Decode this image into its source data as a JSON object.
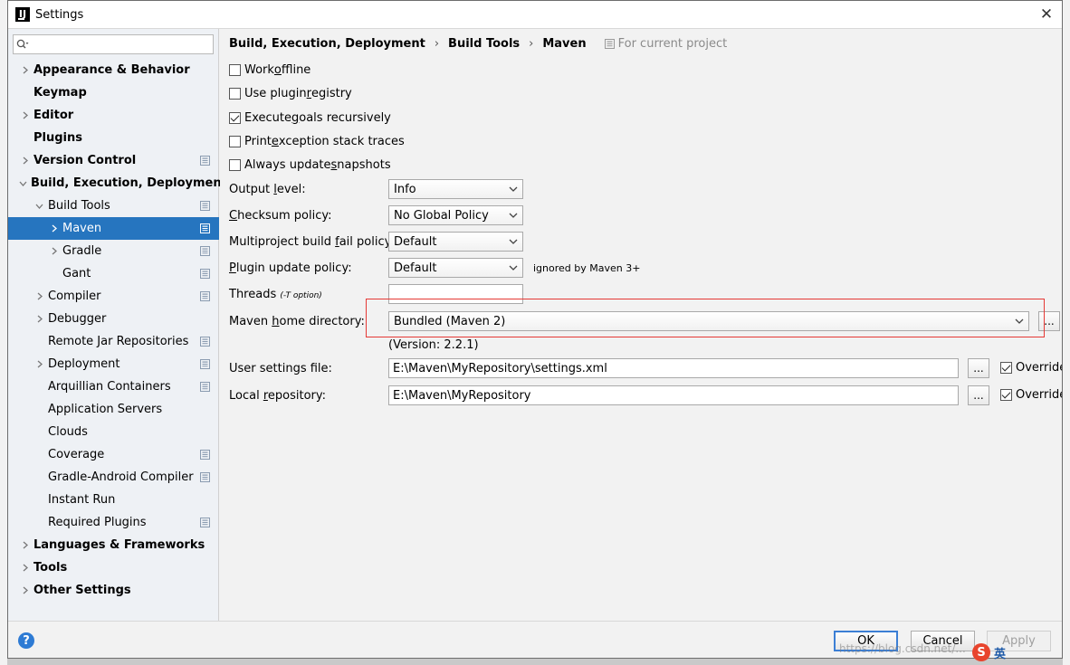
{
  "window": {
    "title": "Settings",
    "app_icon": "intellij-icon"
  },
  "sidebar": {
    "search_placeholder": "",
    "items": [
      {
        "label": "Appearance & Behavior",
        "level": 0,
        "bold": true,
        "arrow": "right",
        "project": false
      },
      {
        "label": "Keymap",
        "level": 0,
        "bold": true,
        "arrow": "none",
        "project": false
      },
      {
        "label": "Editor",
        "level": 0,
        "bold": true,
        "arrow": "right",
        "project": false
      },
      {
        "label": "Plugins",
        "level": 0,
        "bold": true,
        "arrow": "none",
        "project": false
      },
      {
        "label": "Version Control",
        "level": 0,
        "bold": true,
        "arrow": "right",
        "project": true
      },
      {
        "label": "Build, Execution, Deployment",
        "level": 0,
        "bold": true,
        "arrow": "down",
        "project": false
      },
      {
        "label": "Build Tools",
        "level": 1,
        "bold": false,
        "arrow": "down",
        "project": true
      },
      {
        "label": "Maven",
        "level": 2,
        "bold": false,
        "arrow": "right",
        "project": true,
        "selected": true
      },
      {
        "label": "Gradle",
        "level": 2,
        "bold": false,
        "arrow": "right",
        "project": true
      },
      {
        "label": "Gant",
        "level": 2,
        "bold": false,
        "arrow": "none",
        "project": true
      },
      {
        "label": "Compiler",
        "level": 1,
        "bold": false,
        "arrow": "right",
        "project": true
      },
      {
        "label": "Debugger",
        "level": 1,
        "bold": false,
        "arrow": "right",
        "project": false
      },
      {
        "label": "Remote Jar Repositories",
        "level": 1,
        "bold": false,
        "arrow": "none",
        "project": true
      },
      {
        "label": "Deployment",
        "level": 1,
        "bold": false,
        "arrow": "right",
        "project": true
      },
      {
        "label": "Arquillian Containers",
        "level": 1,
        "bold": false,
        "arrow": "none",
        "project": true
      },
      {
        "label": "Application Servers",
        "level": 1,
        "bold": false,
        "arrow": "none",
        "project": false
      },
      {
        "label": "Clouds",
        "level": 1,
        "bold": false,
        "arrow": "none",
        "project": false
      },
      {
        "label": "Coverage",
        "level": 1,
        "bold": false,
        "arrow": "none",
        "project": true
      },
      {
        "label": "Gradle-Android Compiler",
        "level": 1,
        "bold": false,
        "arrow": "none",
        "project": true
      },
      {
        "label": "Instant Run",
        "level": 1,
        "bold": false,
        "arrow": "none",
        "project": false
      },
      {
        "label": "Required Plugins",
        "level": 1,
        "bold": false,
        "arrow": "none",
        "project": true
      },
      {
        "label": "Languages & Frameworks",
        "level": 0,
        "bold": true,
        "arrow": "right",
        "project": false
      },
      {
        "label": "Tools",
        "level": 0,
        "bold": true,
        "arrow": "right",
        "project": false
      },
      {
        "label": "Other Settings",
        "level": 0,
        "bold": true,
        "arrow": "right",
        "project": false
      }
    ]
  },
  "breadcrumb": {
    "parts": [
      "Build, Execution, Deployment",
      "Build Tools",
      "Maven"
    ],
    "sep": "›",
    "for_project": "For current project"
  },
  "options": {
    "work_offline": {
      "pre": "Work ",
      "u": "o",
      "post": "ffline",
      "checked": false
    },
    "use_plugin_registry": {
      "pre": "Use plugin ",
      "u": "r",
      "post": "egistry",
      "checked": false
    },
    "execute_goals": {
      "pre": "Execute ",
      "u": "g",
      "post": "oals recursively",
      "checked": true
    },
    "print_exception": {
      "pre": "Print ",
      "u": "e",
      "post": "xception stack traces",
      "checked": false
    },
    "always_update": {
      "pre": "Always update ",
      "u": "s",
      "post": "napshots",
      "checked": false
    }
  },
  "fields": {
    "output_level": {
      "pre": "Output ",
      "u": "l",
      "post": "evel:",
      "value": "Info"
    },
    "checksum_policy": {
      "pre": "",
      "u": "C",
      "post": "hecksum policy:",
      "value": "No Global Policy"
    },
    "multiproject": {
      "pre": "Multiproject build ",
      "u": "f",
      "post": "ail policy:",
      "value": "Default"
    },
    "plugin_update": {
      "pre": "",
      "u": "P",
      "post": "lugin update policy:",
      "value": "Default",
      "note": "ignored by Maven 3+"
    },
    "threads": {
      "label": "Threads",
      "hint": "(-T option)",
      "value": ""
    },
    "maven_home": {
      "pre": "Maven ",
      "u": "h",
      "post": "ome directory:",
      "value": "Bundled (Maven 2)",
      "version": "(Version: 2.2.1)"
    },
    "user_settings": {
      "label": "User settings file:",
      "value": "E:\\Maven\\MyRepository\\settings.xml",
      "override": "Override",
      "override_checked": true
    },
    "local_repo": {
      "pre": "Local ",
      "u": "r",
      "post": "epository:",
      "value": "E:\\Maven\\MyRepository",
      "override": "Override",
      "override_checked": true
    },
    "browse": "..."
  },
  "footer": {
    "help": "?",
    "ok": "OK",
    "cancel": "Cancel",
    "apply": "Apply",
    "watermark": "https://blog.csdn.net/..."
  },
  "tray": {
    "ime": "英"
  },
  "colors": {
    "selection": "#2675bf",
    "highlight": "#e53935",
    "help": "#2e7bd4"
  }
}
